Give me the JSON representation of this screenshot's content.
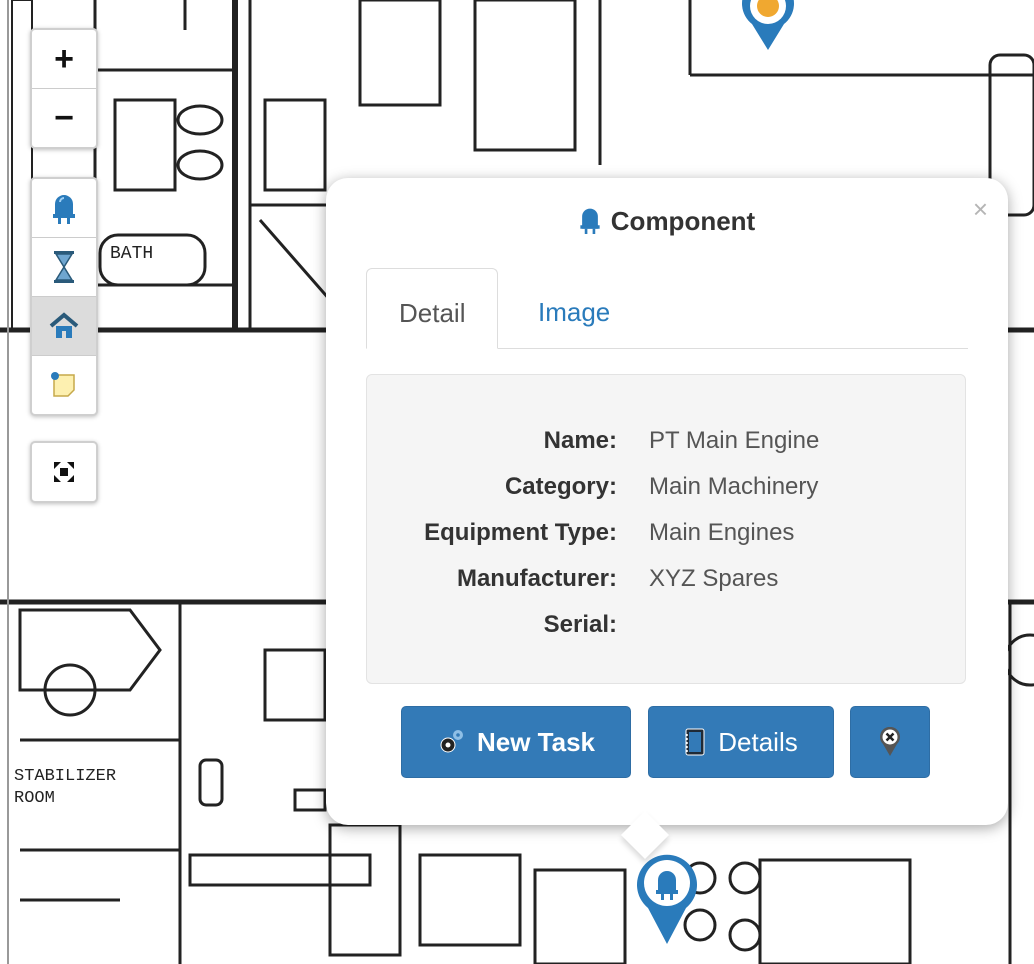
{
  "map": {
    "room_labels": {
      "bath": "BATH",
      "stabilizer_1": "STABILIZER",
      "stabilizer_2": "ROOM"
    },
    "zoom_in_label": "+",
    "zoom_out_label": "−",
    "tools": [
      {
        "icon": "component-icon"
      },
      {
        "icon": "hourglass-icon"
      },
      {
        "icon": "home-icon",
        "active": true
      },
      {
        "icon": "note-icon"
      }
    ],
    "fullscreen_icon": "fullscreen-icon"
  },
  "popup": {
    "title": "Component",
    "close_label": "×",
    "tabs": [
      {
        "label": "Detail",
        "active": true
      },
      {
        "label": "Image",
        "active": false
      }
    ],
    "fields": [
      {
        "label": "Name:",
        "value": "PT Main Engine"
      },
      {
        "label": "Category:",
        "value": "Main Machinery"
      },
      {
        "label": "Equipment Type:",
        "value": "Main Engines"
      },
      {
        "label": "Manufacturer:",
        "value": "XYZ Spares"
      },
      {
        "label": "Serial:",
        "value": ""
      }
    ],
    "buttons": {
      "new_task": "New Task",
      "details": "Details",
      "remove_icon": "remove-marker-icon"
    }
  },
  "colors": {
    "primary": "#337ab7",
    "marker": "#2a7bbb",
    "marker_accent": "#f0a830"
  }
}
